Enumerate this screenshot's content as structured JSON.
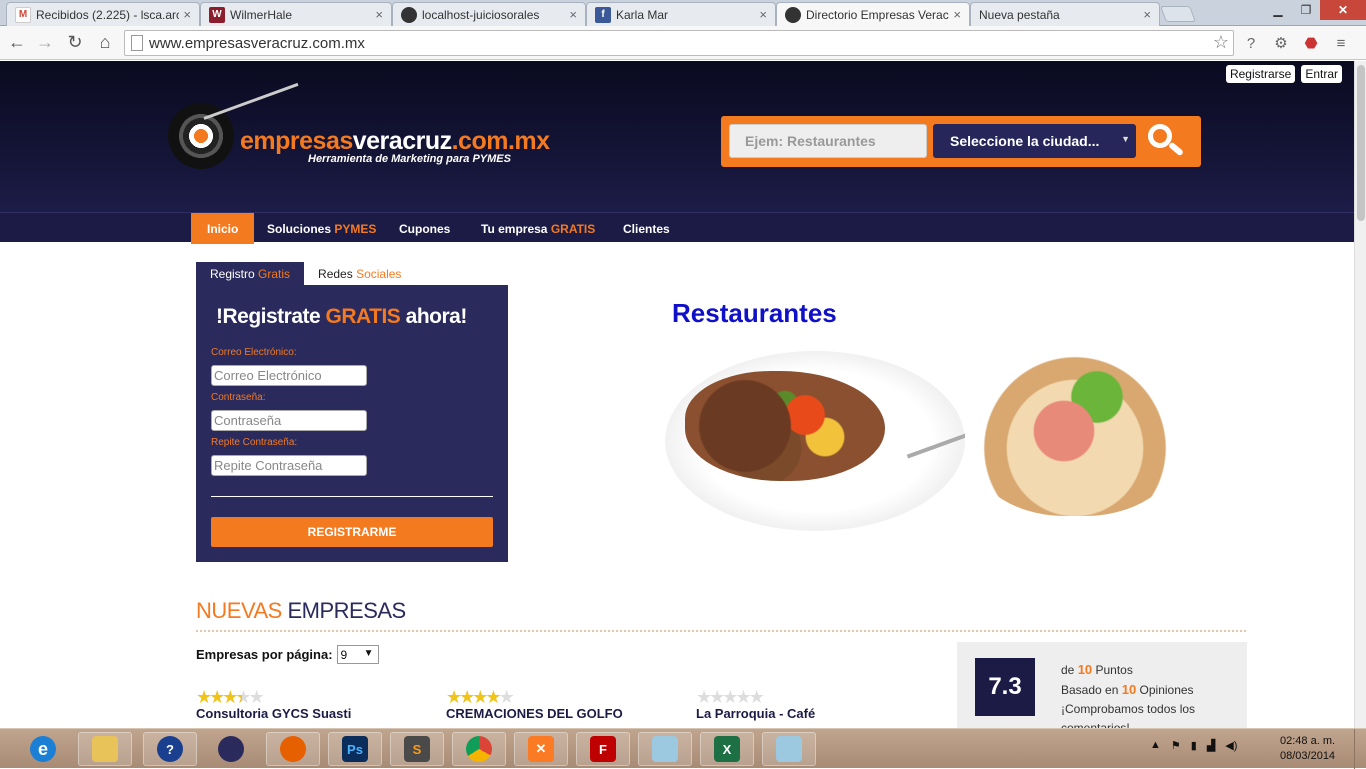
{
  "browser": {
    "tabs": [
      {
        "title": "Recibidos (2.225) - lsca.arc",
        "icon": "gmail-icon",
        "fav": "M",
        "color": "#d44638"
      },
      {
        "title": "WilmerHale",
        "icon": "wilmerhale-icon",
        "fav": "W",
        "color": "#8b1d2c"
      },
      {
        "title": "localhost-juiciosorales",
        "icon": "site-icon",
        "fav": "",
        "color": "#333333"
      },
      {
        "title": "Karla Mar",
        "icon": "facebook-icon",
        "fav": "f",
        "color": "#3b5998"
      },
      {
        "title": "Directorio Empresas Verac",
        "icon": "site-icon",
        "fav": "",
        "color": "#333333"
      },
      {
        "title": "Nueva pestaña",
        "icon": "",
        "fav": "",
        "color": ""
      }
    ],
    "url": "www.empresasveracruz.com.mx"
  },
  "site": {
    "toplinks": {
      "register": "Registrarse",
      "login": "Entrar"
    },
    "logo": {
      "p1": "empresas",
      "p2": "veracruz",
      "p3": ".com.mx",
      "tagline": "Herramienta de Marketing para PYMES"
    },
    "search": {
      "placeholder": "Ejem: Restaurantes",
      "city": "Seleccione la ciudad..."
    },
    "menu": {
      "inicio": "Inicio",
      "soluciones": "Soluciones ",
      "soluciones_hl": "PYMES",
      "cupones": "Cupones",
      "tuempresa": "Tu empresa ",
      "tuempresa_hl": "GRATIS",
      "clientes": "Clientes"
    },
    "register": {
      "tab1": "Registro ",
      "tab1_hl": "Gratis",
      "tab2": "Redes ",
      "tab2_hl": "Sociales",
      "head_a": "!Registrate ",
      "head_b": "GRATIS",
      "head_c": " ahora!",
      "email_label": "Correo Electrónico:",
      "email_ph": "Correo Electrónico",
      "pass_label": "Contraseña:",
      "pass_ph": "Contraseña",
      "repass_label": "Repite Contraseña:",
      "repass_ph": "Repite Contraseña",
      "button": "REGISTRARME"
    },
    "hero_title": "Restaurantes",
    "nuevas": {
      "a": "NUEVAS",
      "b": " EMPRESAS"
    },
    "per_page_label": "Empresas por página:",
    "per_page_value": "9",
    "businesses": [
      {
        "name": "Consultoria GYCS Suasti",
        "rating": 3.5
      },
      {
        "name": "CREMACIONES DEL GOLFO",
        "rating": 4
      },
      {
        "name": "La Parroquia - Café",
        "rating": 0
      }
    ],
    "score": {
      "value": "7.3",
      "l1a": "de ",
      "l1b": "10",
      "l1c": " Puntos",
      "l2a": "Basado en ",
      "l2b": "10",
      "l2c": " Opiniones",
      "l3": "¡Comprobamos todos los",
      "l4": "comentarios!"
    }
  },
  "taskbar": {
    "apps": [
      "internet-explorer-icon",
      "file-explorer-icon",
      "help-icon",
      "app-icon",
      "firefox-icon",
      "photoshop-icon",
      "sublime-icon",
      "chrome-icon",
      "xampp-icon",
      "filezilla-icon",
      "app-icon",
      "excel-icon",
      "app-icon"
    ],
    "time": "02:48 a. m.",
    "date": "08/03/2014"
  }
}
